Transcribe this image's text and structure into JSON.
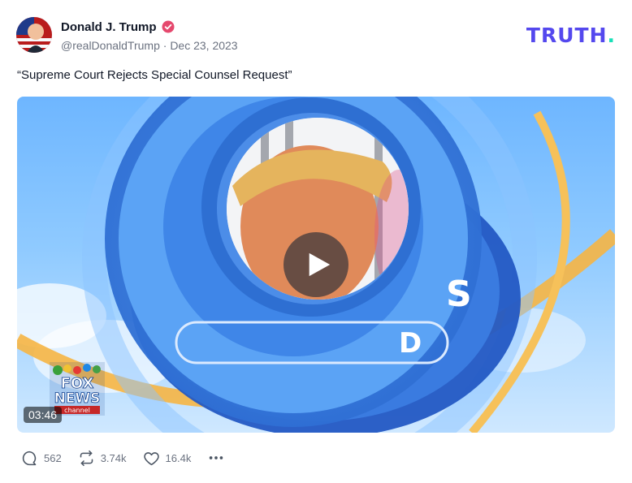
{
  "post": {
    "author_name": "Donald J. Trump",
    "handle": "@realDonaldTrump",
    "separator": "·",
    "date": "Dec 23, 2023",
    "text": "“Supreme Court Rejects Special Counsel Request”"
  },
  "brand": {
    "logo_main": "TRUTH",
    "logo_dot": ".",
    "color": "#5448ee",
    "dot_color": "#17e0b8"
  },
  "media": {
    "duration": "03:46",
    "watermark_lines": [
      "FOX",
      "NEWS",
      "channel"
    ]
  },
  "actions": {
    "replies": "562",
    "retruths": "3.74k",
    "likes": "16.4k"
  },
  "icons": [
    "verified-badge-icon",
    "reply-icon",
    "retruth-icon",
    "like-icon",
    "more-icon",
    "play-icon"
  ]
}
